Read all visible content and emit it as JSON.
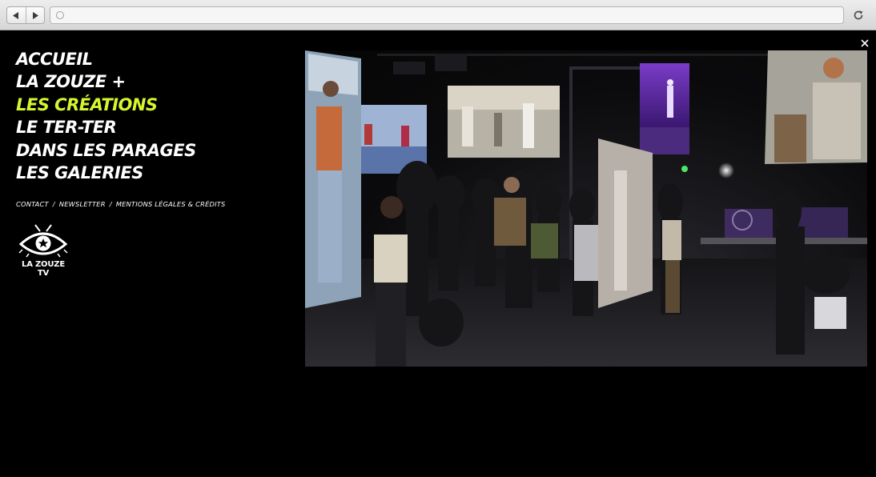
{
  "browser": {
    "back_icon": "back-arrow-icon",
    "forward_icon": "forward-arrow-icon",
    "reload_icon": "reload-icon",
    "url": ""
  },
  "nav": {
    "items": [
      {
        "label": "ACCUEIL",
        "active": false
      },
      {
        "label": "LA ZOUZE +",
        "active": false
      },
      {
        "label": "LES CRÉATIONS",
        "active": true
      },
      {
        "label": "LE TER-TER",
        "active": false
      },
      {
        "label": "DANS LES PARAGES",
        "active": false
      },
      {
        "label": "LES GALERIES",
        "active": false
      }
    ],
    "sub_links": [
      {
        "label": "CONTACT"
      },
      {
        "label": "NEWSLETTER"
      },
      {
        "label": "MENTIONS LÉGALES & CRÉDITS"
      }
    ],
    "separator": "/"
  },
  "logo": {
    "label": "LA ZOUZE TV",
    "icon": "eye-star-icon"
  },
  "lightbox": {
    "close_icon": "close-icon"
  },
  "colors": {
    "background": "#000000",
    "text": "#ffffff",
    "accent": "#d7f52f"
  }
}
